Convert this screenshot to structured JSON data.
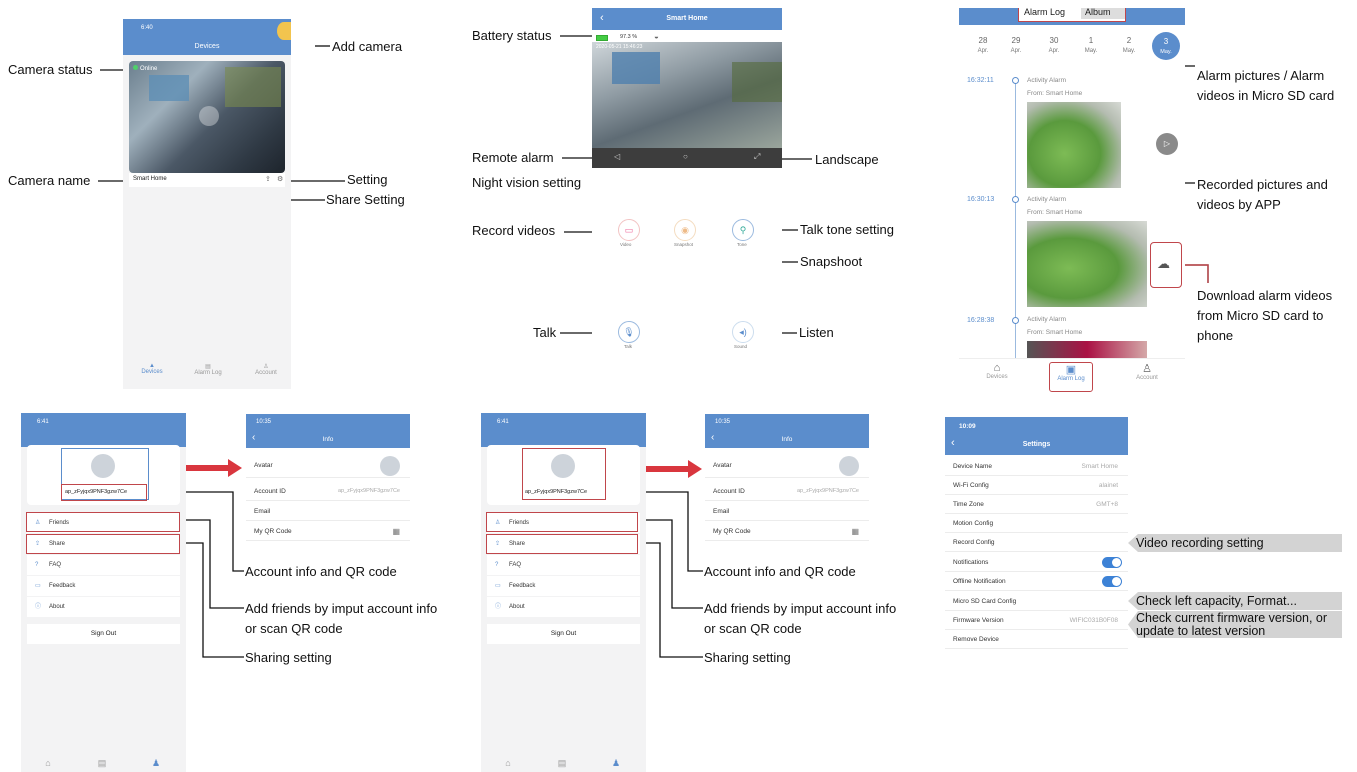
{
  "devices_screen": {
    "time": "6:40",
    "title": "Devices",
    "camera_status": "Online",
    "camera_name": "Smart Home",
    "tabs": [
      "Devices",
      "Alarm Log",
      "Account"
    ]
  },
  "live_screen": {
    "title": "Smart Home",
    "battery": "97.3 %",
    "timestamp": "2020-05-21 15:46:23",
    "buttons": {
      "record": "Video",
      "snapshot": "Snapshot",
      "talk_tone": "Tone",
      "talk": "Talk",
      "listen": "Sound"
    }
  },
  "alarm_screen": {
    "tabs": [
      "Alarm Log",
      "Album"
    ],
    "dates": [
      {
        "day": "28",
        "mon": "Apr."
      },
      {
        "day": "29",
        "mon": "Apr."
      },
      {
        "day": "30",
        "mon": "Apr."
      },
      {
        "day": "1",
        "mon": "May."
      },
      {
        "day": "2",
        "mon": "May."
      },
      {
        "day": "3",
        "mon": "May."
      }
    ],
    "events": [
      {
        "time": "16:32:11",
        "title": "Activity Alarm",
        "from": "From: Smart Home"
      },
      {
        "time": "16:30:13",
        "title": "Activity Alarm",
        "from": "From: Smart Home"
      },
      {
        "time": "16:28:38",
        "title": "Activity Alarm",
        "from": "From: Smart Home"
      }
    ],
    "nav": [
      "Devices",
      "Alarm Log",
      "Account"
    ]
  },
  "account_a": {
    "time": "6:41",
    "account_id": "ap_zFyjqx9PNF3gzw7Ce",
    "menu": [
      "Friends",
      "Share",
      "FAQ",
      "Feedback",
      "About"
    ],
    "sign_out": "Sign Out"
  },
  "info_a": {
    "time": "10:35",
    "title": "Info",
    "rows": [
      {
        "label": "Avatar",
        "value": ""
      },
      {
        "label": "Account ID",
        "value": "ap_zFyjqx9PNF3gzw7Ce"
      },
      {
        "label": "Email",
        "value": ""
      },
      {
        "label": "My QR Code",
        "value": ""
      }
    ]
  },
  "account_b": {
    "time": "6:41",
    "account_id": "ap_zFyjqx9PNF3gzw7Ce",
    "menu": [
      "Friends",
      "Share",
      "FAQ",
      "Feedback",
      "About"
    ],
    "sign_out": "Sign Out"
  },
  "info_b": {
    "time": "10:35",
    "title": "Info",
    "rows": [
      {
        "label": "Avatar",
        "value": ""
      },
      {
        "label": "Account ID",
        "value": "ap_zFyjqx9PNF3gzw7Ce"
      },
      {
        "label": "Email",
        "value": ""
      },
      {
        "label": "My QR Code",
        "value": ""
      }
    ]
  },
  "settings": {
    "time": "10:09",
    "title": "Settings",
    "rows": [
      {
        "label": "Device Name",
        "value": "Smart Home"
      },
      {
        "label": "Wi-Fi Config",
        "value": "alainet"
      },
      {
        "label": "Time Zone",
        "value": "GMT+8"
      },
      {
        "label": "Motion Config",
        "value": ""
      },
      {
        "label": "Record Config",
        "value": ""
      },
      {
        "label": "Notifications",
        "value": ""
      },
      {
        "label": "Offline Notification",
        "value": ""
      },
      {
        "label": "Micro SD Card Config",
        "value": ""
      },
      {
        "label": "Firmware Version",
        "value": "WIFIC031B0F08"
      },
      {
        "label": "Remove Device",
        "value": ""
      }
    ]
  },
  "annotations": {
    "add_camera": "Add camera",
    "camera_status": "Camera status",
    "camera_name": "Camera name",
    "setting": "Setting",
    "share_setting": "Share Setting",
    "battery_status": "Battery status",
    "remote_alarm": "Remote alarm",
    "landscape": "Landscape",
    "night_vision": "Night vision setting",
    "record_videos": "Record videos",
    "talk_tone": "Talk tone setting",
    "snapshoot": "Snapshoot",
    "talk": "Talk",
    "listen": "Listen",
    "alarm_pictures": "Alarm pictures / Alarm videos in Micro SD card",
    "recorded_pictures": "Recorded pictures and videos by APP",
    "download_alarm": "Download alarm videos from Micro SD card to phone",
    "account_info_a": "Account info and QR code",
    "add_friends_a": "Add friends by imput account info or scan QR code",
    "sharing_a": "Sharing setting",
    "account_info_b": "Account info and QR code",
    "add_friends_b": "Add friends by imput account info or scan QR code",
    "sharing_b": "Sharing setting",
    "video_recording": "Video recording setting",
    "check_capacity": "Check left capacity, Format...",
    "check_firmware": "Check current firmware version, or update to latest version"
  },
  "colors": {
    "accent": "#5b8dcc",
    "highlight": "#c0464b",
    "arrow": "#d9363e",
    "callout_bg": "#d3d3d3"
  }
}
